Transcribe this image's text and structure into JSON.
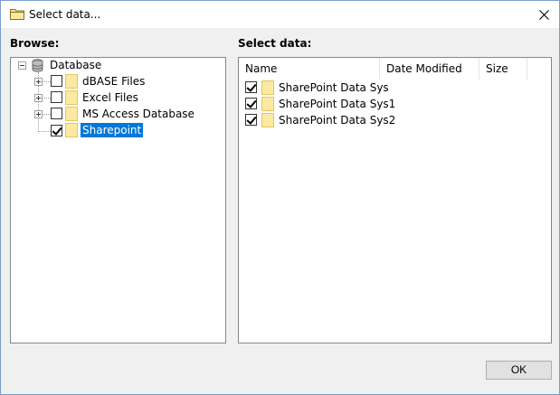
{
  "window": {
    "title": "Select data...",
    "title_icon": "folder-icon",
    "close_icon": "close-icon"
  },
  "browse": {
    "label": "Browse:",
    "root": {
      "label": "Database",
      "icon": "database-icon"
    },
    "items": [
      {
        "label": "dBASE Files",
        "checked": false,
        "expandable": true
      },
      {
        "label": "Excel Files",
        "checked": false,
        "expandable": true
      },
      {
        "label": "MS Access Database",
        "checked": false,
        "expandable": true
      },
      {
        "label": "Sharepoint",
        "checked": true,
        "expandable": false,
        "selected": true
      }
    ]
  },
  "select_data": {
    "label": "Select data:",
    "columns": [
      "Name",
      "Date Modified",
      "Size"
    ],
    "rows": [
      {
        "name": "SharePoint Data Sys",
        "checked": true
      },
      {
        "name": "SharePoint Data Sys1",
        "checked": true
      },
      {
        "name": "SharePoint Data Sys2",
        "checked": true
      }
    ]
  },
  "buttons": {
    "ok": "OK"
  },
  "colors": {
    "selection": "#0078d7",
    "folder": "#fde9a0",
    "border": "#828790"
  }
}
